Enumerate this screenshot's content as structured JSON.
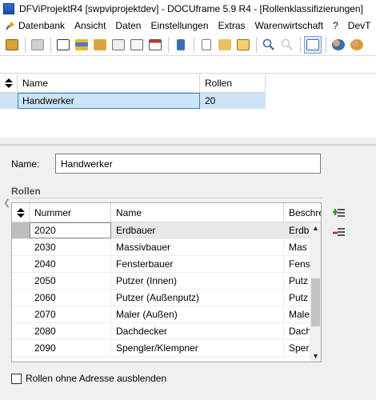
{
  "window": {
    "title": "DFViProjektR4 [swpviprojektdev] - DOCUframe 5.9 R4 - [Rollenklassifizierungen]"
  },
  "menu": {
    "items": [
      "Datenbank",
      "Ansicht",
      "Daten",
      "Einstellungen",
      "Extras",
      "Warenwirtschaft",
      "?",
      "DevT"
    ]
  },
  "toolbar": {
    "icons": [
      "save-icon",
      "print-icon",
      "card-icon",
      "list-icon",
      "folder-icon",
      "attachment-icon",
      "email-icon",
      "calendar-icon",
      "phone-icon",
      "document-icon",
      "open-folder-icon",
      "new-document-icon",
      "search-icon",
      "search-disabled-icon",
      "view-icon",
      "users-icon",
      "user-settings-icon"
    ]
  },
  "top_grid": {
    "columns": [
      "Name",
      "Rollen"
    ],
    "rows": [
      {
        "name": "Handwerker",
        "rollen": "20"
      }
    ]
  },
  "form": {
    "name_label": "Name:",
    "name_value": "Handwerker",
    "section_label": "Rollen"
  },
  "rollen_grid": {
    "columns": [
      "Nummer",
      "Name",
      "Beschre"
    ],
    "rows": [
      {
        "nummer": "2020",
        "name": "Erdbauer",
        "beschr": "Erdb"
      },
      {
        "nummer": "2030",
        "name": "Massivbauer",
        "beschr": "Mas"
      },
      {
        "nummer": "2040",
        "name": "Fensterbauer",
        "beschr": "Fens"
      },
      {
        "nummer": "2050",
        "name": "Putzer (Innen)",
        "beschr": "Putz"
      },
      {
        "nummer": "2060",
        "name": "Putzer (Außenputz)",
        "beschr": "Putz"
      },
      {
        "nummer": "2070",
        "name": "Maler (Außen)",
        "beschr": "Male"
      },
      {
        "nummer": "2080",
        "name": "Dachdecker",
        "beschr": "Dach"
      },
      {
        "nummer": "2090",
        "name": "Spengler/Klempner",
        "beschr": "Sper"
      }
    ]
  },
  "checkbox": {
    "label": "Rollen ohne Adresse ausblenden"
  },
  "colors": {
    "selection": "#cce4f7",
    "accent": "#3c7fb1"
  }
}
